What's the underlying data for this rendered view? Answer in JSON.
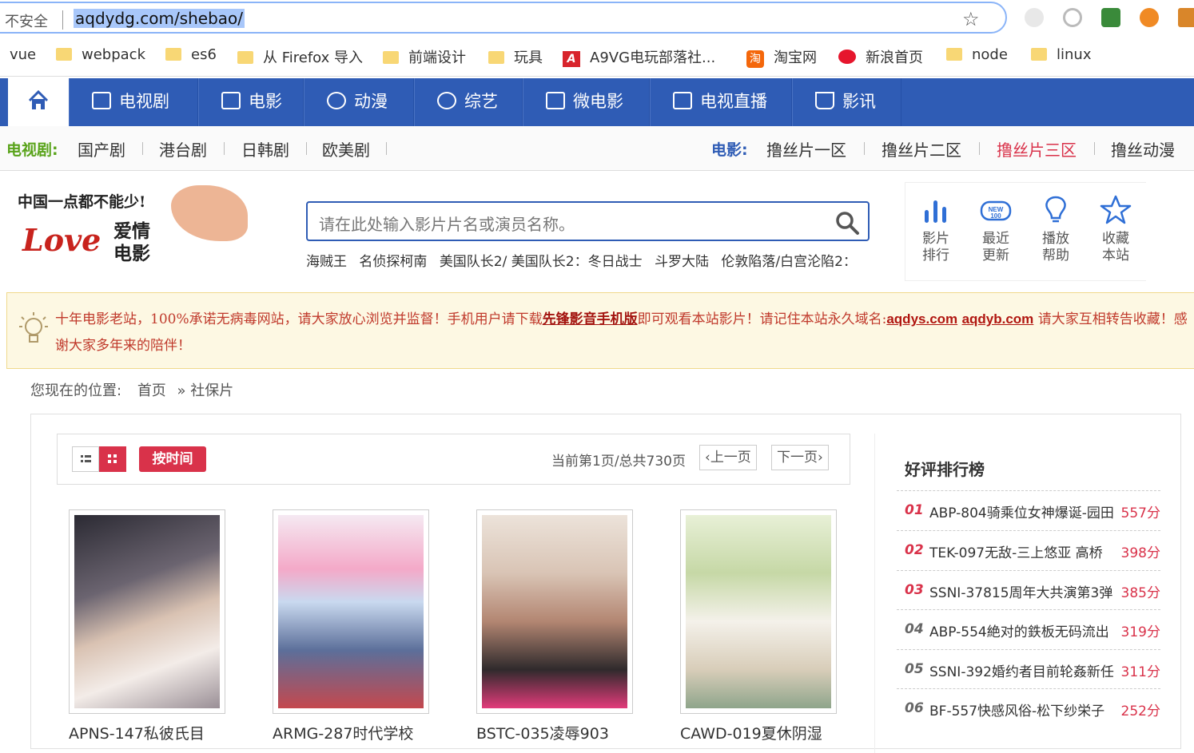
{
  "browser": {
    "security_label": "不安全",
    "url": "aqdydg.com/shebao/",
    "bookmarks": [
      "vue",
      "webpack",
      "es6",
      "从 Firefox 导入",
      "前端设计",
      "玩具",
      "A9VG电玩部落社...",
      "淘宝网",
      "新浪首页",
      "node",
      "linux"
    ]
  },
  "nav": {
    "items": [
      "电视剧",
      "电影",
      "动漫",
      "综艺",
      "微电影",
      "电视直播",
      "影讯"
    ]
  },
  "subnav": {
    "tv_title": "电视剧:",
    "tv_items": [
      "国产剧",
      "港台剧",
      "日韩剧",
      "欧美剧"
    ],
    "movie_title": "电影:",
    "movie_items": [
      "撸丝片一区",
      "撸丝片二区",
      "撸丝片三区",
      "撸丝动漫"
    ],
    "active_color": "#d9324a"
  },
  "logo": {
    "line1": "中国一点都不能少!",
    "love": "Love",
    "line2a": "爱情",
    "line2b": "电影"
  },
  "search": {
    "placeholder": "请在此处输入影片片名或演员名称。",
    "hot": [
      "海贼王",
      "名侦探柯南",
      "美国队长2/ 美国队长2：冬日战士",
      "斗罗大陆",
      "伦敦陷落/白宫沦陷2："
    ]
  },
  "tools": [
    {
      "line1": "影片",
      "line2": "排行",
      "icon": "bar-chart-icon"
    },
    {
      "line1": "最近",
      "line2": "更新",
      "icon": "new-badge-icon"
    },
    {
      "line1": "播放",
      "line2": "帮助",
      "icon": "lightbulb-icon"
    },
    {
      "line1": "收藏",
      "line2": "本站",
      "icon": "star-icon"
    }
  ],
  "notice": {
    "part1": "十年电影老站，100%承诺无病毒网站，请大家放心浏览并监督！手机用户请下载",
    "link1": "先锋影音手机版",
    "part2": "即可观看本站影片！请记住本站永久域名:",
    "domain1": "aqdys.com",
    "domain2": "aqdyb.com",
    "part3": " 请大家互相转告收藏！感谢大家多年来的陪伴！"
  },
  "breadcrumb": {
    "label": "您现在的位置:",
    "home": "首页",
    "current": "» 社保片"
  },
  "toolbar": {
    "sort": "按时间",
    "page_info": "当前第1页/总共730页",
    "prev": "上一页",
    "next": "下一页"
  },
  "movies": [
    {
      "title": "APNS-147私彼氏目"
    },
    {
      "title": "ARMG-287时代学校"
    },
    {
      "title": "BSTC-035凌辱903"
    },
    {
      "title": "CAWD-019夏休阴湿"
    }
  ],
  "ranking": {
    "title": "好评排行榜",
    "items": [
      {
        "num": "01",
        "name": "ABP-804骑乘位女神爆诞-园田",
        "score": "557分"
      },
      {
        "num": "02",
        "name": "TEK-097无敌-三上悠亚 高桥",
        "score": "398分"
      },
      {
        "num": "03",
        "name": "SSNI-37815周年大共演第3弹",
        "score": "385分"
      },
      {
        "num": "04",
        "name": "ABP-554絶对的鉄板无码流出",
        "score": "319分"
      },
      {
        "num": "05",
        "name": "SSNI-392婚约者目前轮姦新任",
        "score": "311分"
      },
      {
        "num": "06",
        "name": "BF-557快感风俗-松下纱栄子",
        "score": "252分"
      }
    ]
  },
  "colors": {
    "nav_blue": "#2f5cb5",
    "accent_red": "#d9324a",
    "green": "#59a31a"
  }
}
